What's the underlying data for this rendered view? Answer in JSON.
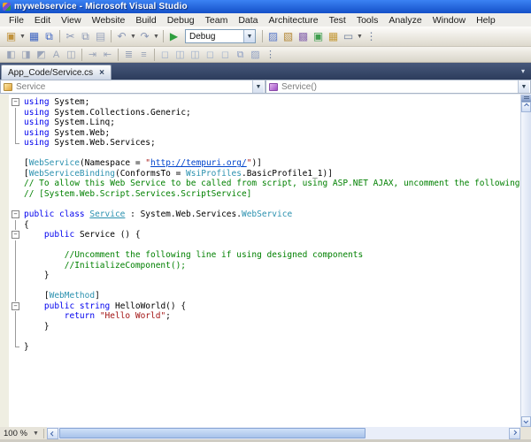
{
  "window": {
    "title": "mywebservice - Microsoft Visual Studio"
  },
  "menu": {
    "items": [
      "File",
      "Edit",
      "View",
      "Website",
      "Build",
      "Debug",
      "Team",
      "Data",
      "Architecture",
      "Test",
      "Tools",
      "Analyze",
      "Window",
      "Help"
    ]
  },
  "toolbar": {
    "debug_combo": "Debug",
    "row1": [
      {
        "type": "icon",
        "name": "new-item-icon",
        "glyph": "▣",
        "color": "#c0923c"
      },
      {
        "type": "caret"
      },
      {
        "type": "icon",
        "name": "save-icon",
        "glyph": "▦",
        "color": "#3a62c2"
      },
      {
        "type": "icon",
        "name": "save-all-icon",
        "glyph": "⧉",
        "color": "#3a62c2"
      },
      {
        "type": "sep"
      },
      {
        "type": "icon",
        "name": "cut-icon",
        "glyph": "✂",
        "color": "#8a97b5"
      },
      {
        "type": "icon",
        "name": "copy-icon",
        "glyph": "⧉",
        "color": "#8a97b5"
      },
      {
        "type": "icon",
        "name": "paste-icon",
        "glyph": "▤",
        "color": "#9aa5bd"
      },
      {
        "type": "sep"
      },
      {
        "type": "icon",
        "name": "undo-icon",
        "glyph": "↶",
        "color": "#8a97b5"
      },
      {
        "type": "caret"
      },
      {
        "type": "icon",
        "name": "redo-icon",
        "glyph": "↷",
        "color": "#8a97b5"
      },
      {
        "type": "caret"
      },
      {
        "type": "sep"
      },
      {
        "type": "icon",
        "name": "start-debugging-icon",
        "glyph": "▶",
        "color": "#2e9e3e"
      },
      {
        "type": "combo"
      },
      {
        "type": "sep"
      },
      {
        "type": "icon",
        "name": "find-in-files-icon",
        "glyph": "▨",
        "color": "#5a79c9"
      },
      {
        "type": "icon",
        "name": "solution-explorer-icon",
        "glyph": "▧",
        "color": "#b58a3a"
      },
      {
        "type": "icon",
        "name": "properties-window-icon",
        "glyph": "▩",
        "color": "#8a6ab0"
      },
      {
        "type": "icon",
        "name": "object-browser-icon",
        "glyph": "▣",
        "color": "#3f9e4e"
      },
      {
        "type": "icon",
        "name": "toolbox-icon",
        "glyph": "▦",
        "color": "#c59a38"
      },
      {
        "type": "icon",
        "name": "command-window-icon",
        "glyph": "▭",
        "color": "#6f7f9d"
      },
      {
        "type": "caret"
      },
      {
        "type": "icon",
        "name": "toolbar-overflow-icon",
        "glyph": "⋮",
        "color": "#6f7f9d"
      }
    ],
    "row2": [
      {
        "type": "icon",
        "name": "display-control-outline-icon",
        "glyph": "◧",
        "color": "#9aa4b8"
      },
      {
        "type": "icon",
        "name": "select-pointer-icon",
        "glyph": "◨",
        "color": "#9aa4b8"
      },
      {
        "type": "icon",
        "name": "pointer-alt-icon",
        "glyph": "◩",
        "color": "#9aa4b8"
      },
      {
        "type": "icon",
        "name": "font-size-icon",
        "glyph": "A",
        "color": "#9aa4b8"
      },
      {
        "type": "icon",
        "name": "grid-icon",
        "glyph": "◫",
        "color": "#9aa4b8"
      },
      {
        "type": "sep"
      },
      {
        "type": "icon",
        "name": "indent-icon",
        "glyph": "⇥",
        "color": "#9aa4b8"
      },
      {
        "type": "icon",
        "name": "outdent-icon",
        "glyph": "⇤",
        "color": "#9aa4b8"
      },
      {
        "type": "sep"
      },
      {
        "type": "icon",
        "name": "comment-lines-icon",
        "glyph": "≣",
        "color": "#9aa4b8"
      },
      {
        "type": "icon",
        "name": "uncomment-lines-icon",
        "glyph": "≡",
        "color": "#9aa4b8"
      },
      {
        "type": "sep"
      },
      {
        "type": "icon",
        "name": "toggle-bookmark-icon",
        "glyph": "◻",
        "color": "#9fb0cc"
      },
      {
        "type": "icon",
        "name": "prev-bookmark-icon",
        "glyph": "◫",
        "color": "#9fb0cc"
      },
      {
        "type": "icon",
        "name": "next-bookmark-icon",
        "glyph": "◫",
        "color": "#9fb0cc"
      },
      {
        "type": "icon",
        "name": "prev-bookmark-folder-icon",
        "glyph": "◻",
        "color": "#9fb0cc"
      },
      {
        "type": "icon",
        "name": "next-bookmark-folder-icon",
        "glyph": "◻",
        "color": "#9fb0cc"
      },
      {
        "type": "icon",
        "name": "clear-bookmarks-icon",
        "glyph": "⧉",
        "color": "#8fa0c4"
      },
      {
        "type": "icon",
        "name": "bookmark-window-icon",
        "glyph": "▨",
        "color": "#8fa0c4"
      },
      {
        "type": "icon",
        "name": "toolbar2-overflow-icon",
        "glyph": "⋮",
        "color": "#6f7f9d"
      }
    ]
  },
  "tabs": {
    "active": "App_Code/Service.cs",
    "close_glyph": "×"
  },
  "navbar": {
    "class_value": "Service",
    "method_value": "Service()"
  },
  "editor": {
    "lines": [
      {
        "f": "box",
        "s": [
          [
            "kw",
            "using"
          ],
          [
            "pl",
            " System;"
          ]
        ]
      },
      {
        "f": "bar",
        "s": [
          [
            "kw",
            "using"
          ],
          [
            "pl",
            " System.Collections.Generic;"
          ]
        ]
      },
      {
        "f": "bar",
        "s": [
          [
            "kw",
            "using"
          ],
          [
            "pl",
            " System.Linq;"
          ]
        ]
      },
      {
        "f": "bar",
        "s": [
          [
            "kw",
            "using"
          ],
          [
            "pl",
            " System.Web;"
          ]
        ]
      },
      {
        "f": "end",
        "s": [
          [
            "kw",
            "using"
          ],
          [
            "pl",
            " System.Web.Services;"
          ]
        ]
      },
      {
        "f": "",
        "s": []
      },
      {
        "f": "",
        "s": [
          [
            "pl",
            "["
          ],
          [
            "ty",
            "WebService"
          ],
          [
            "pl",
            "(Namespace = "
          ],
          [
            "str",
            "\""
          ],
          [
            "link",
            "http://tempuri.org/"
          ],
          [
            "str",
            "\""
          ],
          [
            "pl",
            ")]"
          ]
        ]
      },
      {
        "f": "",
        "s": [
          [
            "pl",
            "["
          ],
          [
            "ty",
            "WebServiceBinding"
          ],
          [
            "pl",
            "(ConformsTo = "
          ],
          [
            "ty",
            "WsiProfiles"
          ],
          [
            "pl",
            ".BasicProfile1_1)]"
          ]
        ]
      },
      {
        "f": "",
        "s": [
          [
            "cm",
            "// To allow this Web Service to be called from script, using ASP.NET AJAX, uncomment the following line. "
          ]
        ]
      },
      {
        "f": "",
        "s": [
          [
            "cm",
            "// [System.Web.Script.Services.ScriptService]"
          ]
        ]
      },
      {
        "f": "",
        "s": []
      },
      {
        "f": "box",
        "s": [
          [
            "kw",
            "public class "
          ],
          [
            "tyu",
            "Service"
          ],
          [
            "pl",
            " : System.Web.Services."
          ],
          [
            "ty",
            "WebService"
          ]
        ]
      },
      {
        "f": "bar",
        "s": [
          [
            "pl",
            "{"
          ]
        ]
      },
      {
        "f": "box",
        "s": [
          [
            "pl",
            "    "
          ],
          [
            "kw",
            "public"
          ],
          [
            "pl",
            " Service () {"
          ]
        ]
      },
      {
        "f": "bar",
        "s": []
      },
      {
        "f": "bar",
        "s": [
          [
            "cm",
            "        //Uncomment the following line if using designed components"
          ]
        ]
      },
      {
        "f": "bar",
        "s": [
          [
            "cm",
            "        //InitializeComponent();"
          ]
        ]
      },
      {
        "f": "bar",
        "s": [
          [
            "pl",
            "    }"
          ]
        ]
      },
      {
        "f": "bar",
        "s": []
      },
      {
        "f": "bar",
        "s": [
          [
            "pl",
            "    ["
          ],
          [
            "ty",
            "WebMethod"
          ],
          [
            "pl",
            "]"
          ]
        ]
      },
      {
        "f": "box",
        "s": [
          [
            "pl",
            "    "
          ],
          [
            "kw",
            "public string"
          ],
          [
            "pl",
            " HelloWorld() {"
          ]
        ]
      },
      {
        "f": "bar",
        "s": [
          [
            "kw",
            "        return"
          ],
          [
            "pl",
            " "
          ],
          [
            "str",
            "\"Hello World\""
          ],
          [
            "pl",
            ";"
          ]
        ]
      },
      {
        "f": "bar",
        "s": [
          [
            "pl",
            "    }"
          ]
        ]
      },
      {
        "f": "bar",
        "s": []
      },
      {
        "f": "end",
        "s": [
          [
            "pl",
            "}"
          ]
        ]
      }
    ]
  },
  "statusbar": {
    "zoom": "100 %"
  }
}
